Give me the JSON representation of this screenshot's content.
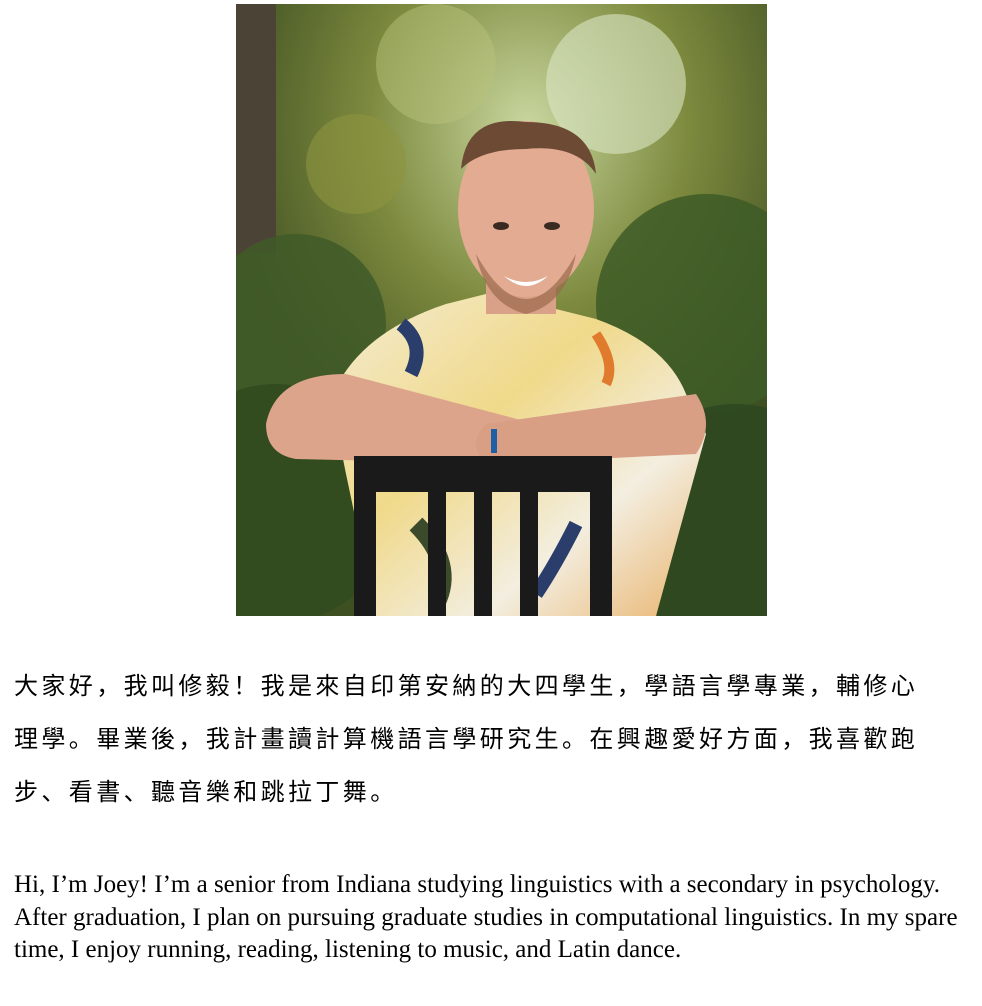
{
  "photo": {
    "alt": "Portrait photo of Joey smiling, leaning on the back of a black chair, wearing a patterned shirt, with green trees behind"
  },
  "intro_zh": {
    "lines": [
      "大家好，我叫修毅！我是來自印第安納的大四學生，學語言學專業，輔修心",
      "理學。畢業後，我計畫讀計算機語言學研究生。在興趣愛好方面，我喜歡跑",
      "步、看書、聽音樂和跳拉丁舞。"
    ]
  },
  "intro_en": {
    "text": "Hi, I’m Joey! I’m a senior from Indiana studying linguistics with a secondary in psychology. After graduation, I plan on pursuing graduate studies in computational linguistics. In my spare time, I enjoy running, reading, listening to music, and Latin dance."
  }
}
